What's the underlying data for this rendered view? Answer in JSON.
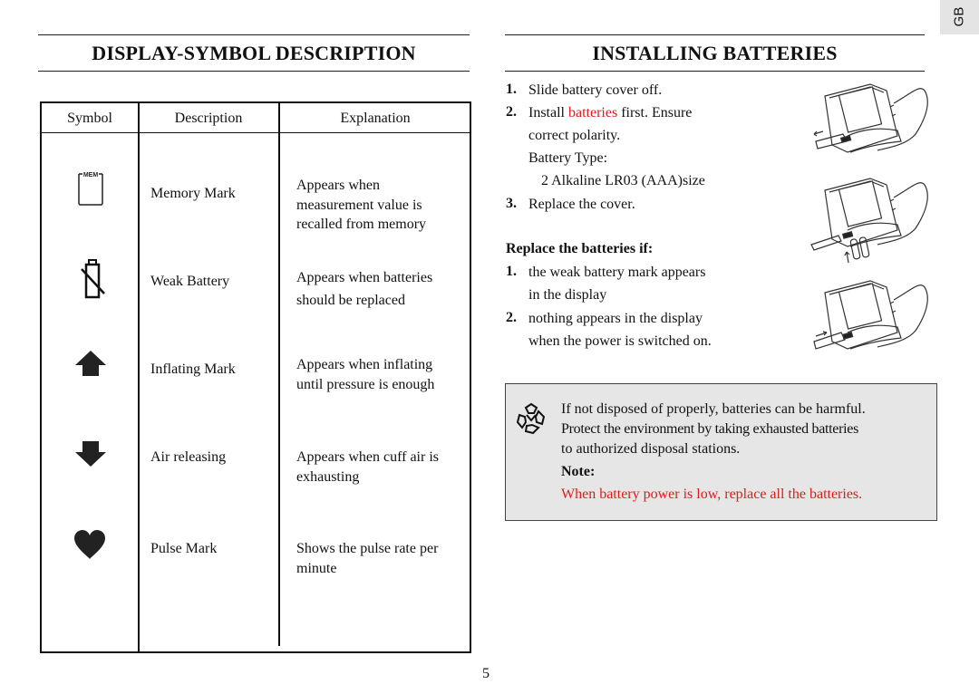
{
  "page": {
    "language_tab": "GB",
    "page_number": "5"
  },
  "left_section": {
    "title": "DISPLAY-SYMBOL  DESCRIPTION",
    "table": {
      "headers": [
        "Symbol",
        "Description",
        "Explanation"
      ],
      "rows": [
        {
          "symbol_icon": "memory-mark-icon",
          "symbol_label": "MEM",
          "description": "Memory Mark",
          "explanation": [
            "Appears when",
            "measurement value is",
            "recalled from memory"
          ]
        },
        {
          "symbol_icon": "weak-battery-icon",
          "description": "Weak Battery",
          "explanation": [
            "Appears when batteries",
            "should be replaced"
          ]
        },
        {
          "symbol_icon": "inflating-arrow-up-icon",
          "description": "Inflating Mark",
          "explanation": [
            "Appears when inflating",
            "until pressure is enough"
          ]
        },
        {
          "symbol_icon": "air-releasing-arrow-down-icon",
          "description": "Air releasing",
          "explanation": [
            "Appears when cuff air is",
            "exhausting"
          ]
        },
        {
          "symbol_icon": "pulse-heart-icon",
          "description": "Pulse Mark",
          "explanation": [
            "Shows the pulse rate per",
            "minute"
          ]
        }
      ]
    }
  },
  "right_section": {
    "title": "INSTALLING  BATTERIES",
    "steps": [
      {
        "num": "1.",
        "text": "Slide battery cover off."
      },
      {
        "num": "2.",
        "text_before": "Install ",
        "text_highlight": "batteries",
        "text_after": " first.  Ensure",
        "continuation": [
          "correct polarity.",
          "Battery Type:",
          "2 Alkaline LR03 (AAA)size"
        ]
      },
      {
        "num": "3.",
        "text": "Replace the cover."
      }
    ],
    "replace_heading": "Replace the batteries if:",
    "replace_conditions": [
      {
        "num": "1.",
        "lines": [
          "the weak battery mark appears",
          "in the display"
        ]
      },
      {
        "num": "2.",
        "lines": [
          "nothing appears in the display",
          "when the power is switched on."
        ]
      }
    ],
    "illustrations": [
      "Device with battery cover sliding off",
      "Device with batteries being inserted",
      "Device with battery cover sliding back on"
    ],
    "note_box": {
      "icon": "recycle-icon",
      "lines": [
        "If not disposed of properly, batteries can  be harmful.",
        "Protect the environment by taking exhausted batteries",
        "to authorized disposal stations."
      ],
      "note_label": "Note:",
      "note_text": "When battery power is low, replace all the batteries."
    }
  },
  "colors": {
    "highlight_red": "#e01a1a",
    "note_bg": "#e6e6e6",
    "tab_bg": "#e4e4e4"
  }
}
